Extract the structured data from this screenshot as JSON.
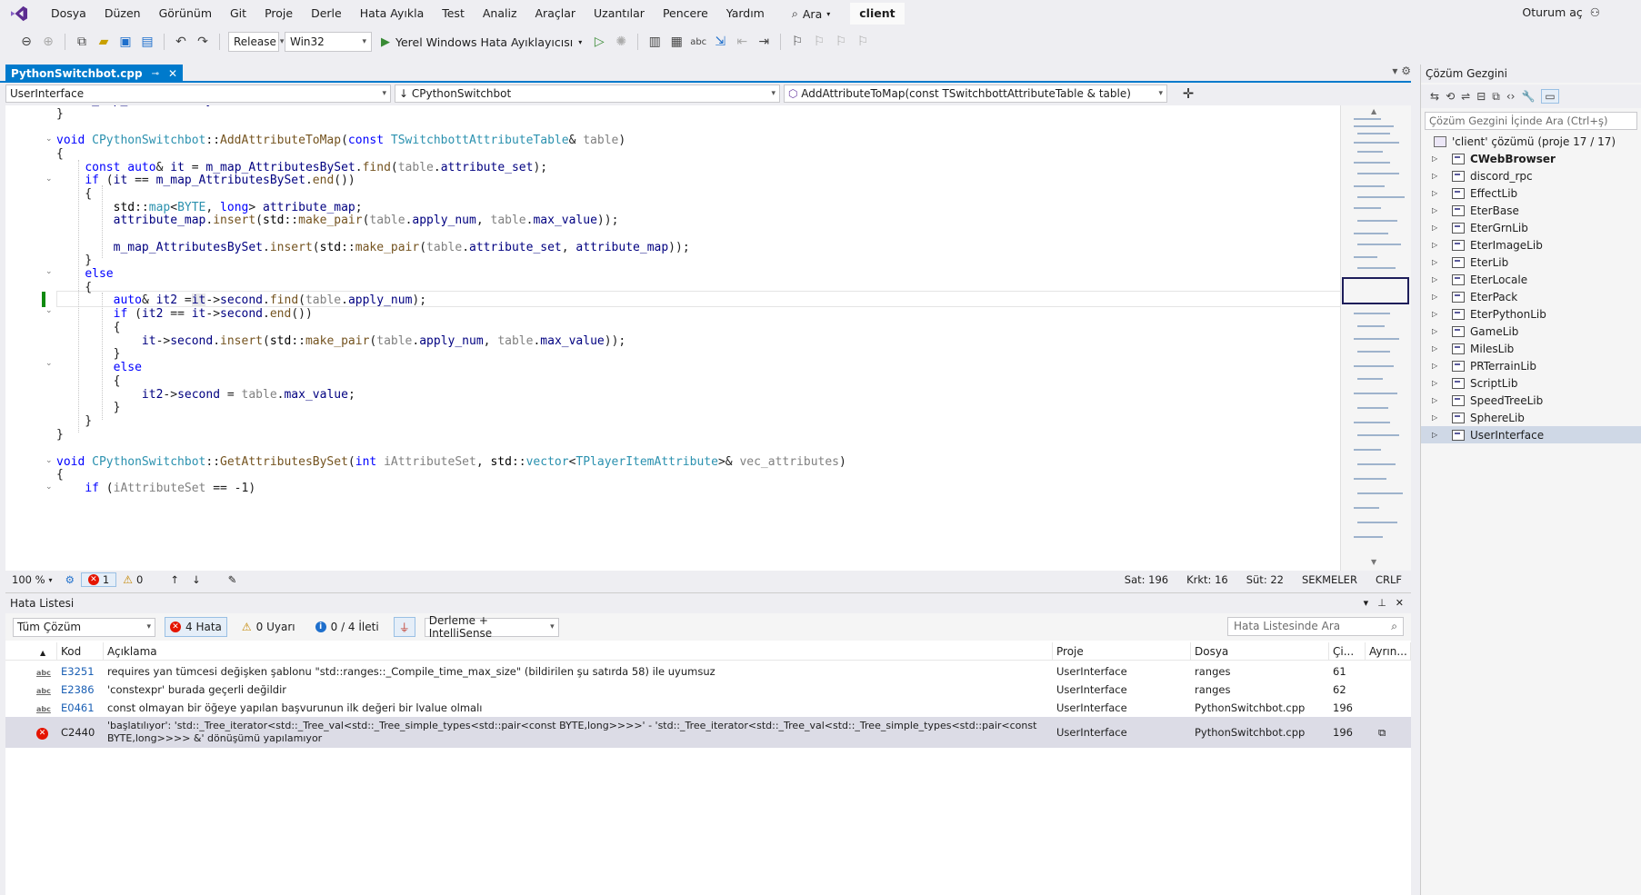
{
  "menu": {
    "items": [
      "Dosya",
      "Düzen",
      "Görünüm",
      "Git",
      "Proje",
      "Derle",
      "Hata Ayıkla",
      "Test",
      "Analiz",
      "Araçlar",
      "Uzantılar",
      "Pencere",
      "Yardım"
    ],
    "search_label": "Ara",
    "solution_name": "client",
    "signin": "Oturum aç"
  },
  "toolbar": {
    "config": "Release",
    "platform": "Win32",
    "debugger": "Yerel Windows Hata Ayıklayıcısı"
  },
  "editor": {
    "tab_title": "PythonSwitchbot.cpp",
    "nav_project": "UserInterface",
    "nav_class": "CPythonSwitchbot",
    "nav_member": "AddAttributeToMap(const TSwitchbottAttributeTable & table)",
    "status": {
      "zoom": "100 %",
      "errors": "1",
      "warnings": "0",
      "line": "Sat: 196",
      "char": "Krkt: 16",
      "col": "Süt: 22",
      "tabs": "SEKMELER",
      "eol": "CRLF"
    }
  },
  "error_list": {
    "title": "Hata Listesi",
    "scope": "Tüm Çözüm",
    "errors_filter": "4 Hata",
    "warnings_filter": "0 Uyarı",
    "messages_filter": "0 / 4 İleti",
    "build_filter": "Derleme + IntelliSense",
    "search_placeholder": "Hata Listesinde Ara",
    "columns": [
      "Kod",
      "Açıklama",
      "Proje",
      "Dosya",
      "Çi...",
      "Ayrın..."
    ],
    "rows": [
      {
        "code": "E3251",
        "desc": "requires yan tümcesi değişken şablonu \"std::ranges::_Compile_time_max_size\" (bildirilen şu satırda 58) ile uyumsuz",
        "project": "UserInterface",
        "file": "ranges",
        "line": "61"
      },
      {
        "code": "E2386",
        "desc": "'constexpr' burada geçerli değildir",
        "project": "UserInterface",
        "file": "ranges",
        "line": "62"
      },
      {
        "code": "E0461",
        "desc": "const olmayan bir öğeye yapılan başvurunun ilk değeri bir lvalue olmalı",
        "project": "UserInterface",
        "file": "PythonSwitchbot.cpp",
        "line": "196"
      },
      {
        "code": "C2440",
        "desc": "'başlatılıyor': 'std::_Tree_iterator<std::_Tree_val<std::_Tree_simple_types<std::pair<const BYTE,long>>>>' - 'std::_Tree_iterator<std::_Tree_val<std::_Tree_simple_types<std::pair<const BYTE,long>>>> &' dönüşümü yapılamıyor",
        "project": "UserInterface",
        "file": "PythonSwitchbot.cpp",
        "line": "196"
      }
    ]
  },
  "solution_explorer": {
    "title": "Çözüm Gezgini",
    "search_placeholder": "Çözüm Gezgini İçinde Ara (Ctrl+ş)",
    "solution_label": "'client' çözümü (proje 17 / 17)",
    "projects": [
      "CWebBrowser",
      "discord_rpc",
      "EffectLib",
      "EterBase",
      "EterGrnLib",
      "EterImageLib",
      "EterLib",
      "EterLocale",
      "EterPack",
      "EterPythonLib",
      "GameLib",
      "MilesLib",
      "PRTerrainLib",
      "ScriptLib",
      "SpeedTreeLib",
      "SphereLib",
      "UserInterface"
    ],
    "bold_project": "CWebBrowser",
    "selected_project": "UserInterface"
  },
  "colors": {
    "accent": "#007acc",
    "error": "#e51400",
    "keyword": "#0000ff",
    "type": "#2b91af"
  }
}
